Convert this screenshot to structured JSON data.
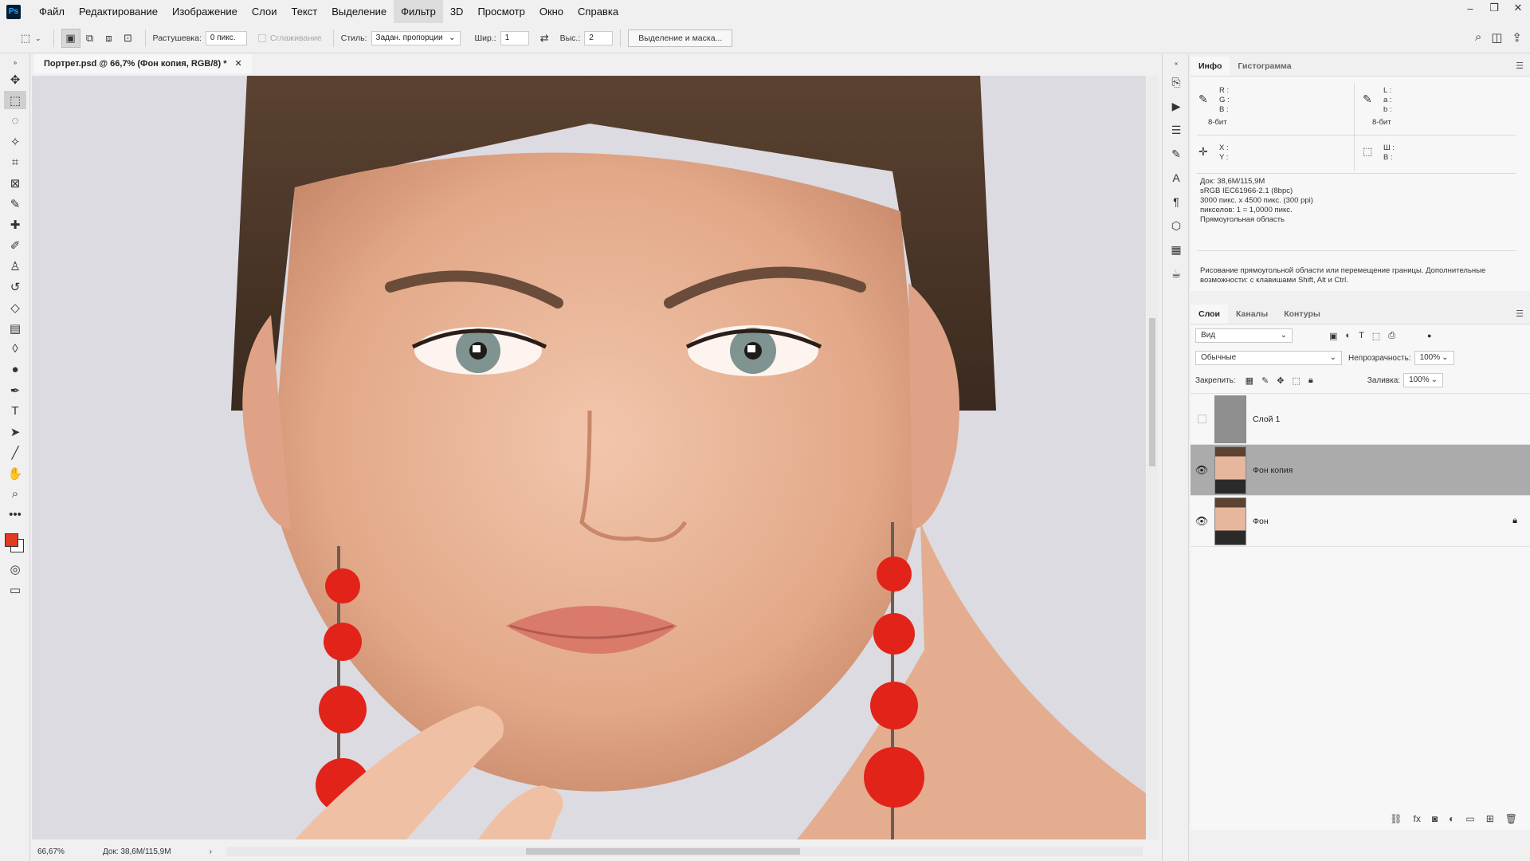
{
  "menu": {
    "logo": "Ps",
    "items": [
      "Файл",
      "Редактирование",
      "Изображение",
      "Слои",
      "Текст",
      "Выделение",
      "Фильтр",
      "3D",
      "Просмотр",
      "Окно",
      "Справка"
    ]
  },
  "options": {
    "feather_label": "Растушевка:",
    "feather_value": "0 пикс.",
    "antialias_label": "Сглаживание",
    "style_label": "Стиль:",
    "style_value": "Задан. пропорции",
    "width_label": "Шир.:",
    "width_value": "1",
    "height_label": "Выс.:",
    "height_value": "2",
    "select_mask_button": "Выделение и маска..."
  },
  "document": {
    "tab_title": "Портрет.psd @ 66,7% (Фон копия, RGB/8) *",
    "zoom": "66,67%",
    "doc_size": "Док: 38,6M/115,9M"
  },
  "info_panel": {
    "tabs": [
      "Инфо",
      "Гистограмма"
    ],
    "rgb_labels": "R :\nG :\nB :",
    "lab_labels": "L :\na :\nb :",
    "bit_left": "8-бит",
    "bit_right": "8-бит",
    "xy_labels": "X :\nY :",
    "wh_labels": "Ш :\nВ :",
    "doc_info": "Док: 38,6M/115,9M\nsRGB IEC61966-2.1 (8bpc)\n3000 пикс. x 4500 пикс. (300 ppi)\nпикселов: 1 = 1,0000 пикс.\nПрямоугольная область",
    "hint": "Рисование прямоугольной области или перемещение границы. Дополнительные возможности: с клавишами Shift, Alt и Ctrl."
  },
  "layers_panel": {
    "tabs": [
      "Слои",
      "Каналы",
      "Контуры"
    ],
    "filter_value": "Вид",
    "blend_mode": "Обычные",
    "opacity_label": "Непрозрачность:",
    "opacity_value": "100%",
    "lock_label": "Закрепить:",
    "fill_label": "Заливка:",
    "fill_value": "100%",
    "layers": [
      {
        "name": "Слой 1",
        "visible": false,
        "selected": false,
        "locked": false
      },
      {
        "name": "Фон копия",
        "visible": true,
        "selected": true,
        "locked": false
      },
      {
        "name": "Фон",
        "visible": true,
        "selected": false,
        "locked": true
      }
    ]
  },
  "colors": {
    "foreground": "#e23a1c",
    "background": "#ffffff",
    "accent": "#31a8ff"
  }
}
